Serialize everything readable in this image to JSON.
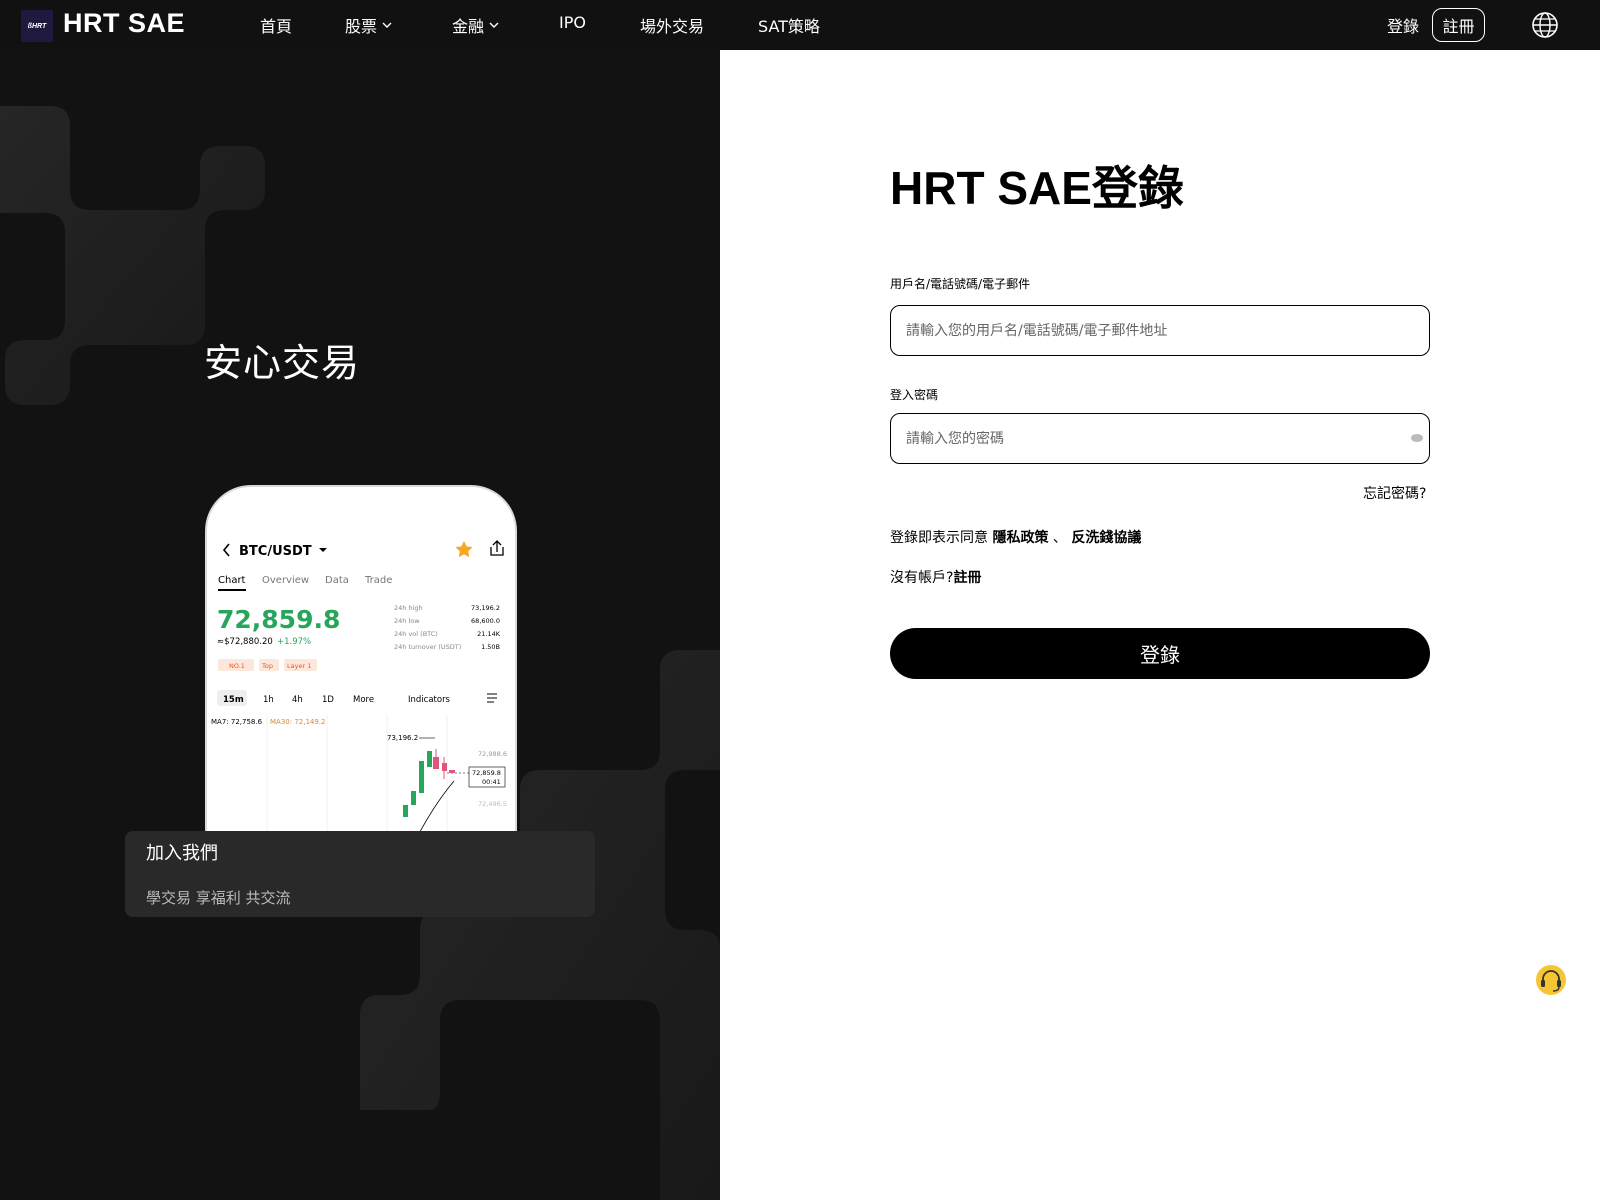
{
  "nav": {
    "logo_text": "ßHRT",
    "brand": "HRT SAE",
    "items": [
      {
        "label": "首頁",
        "dropdown": false
      },
      {
        "label": "股票",
        "dropdown": true
      },
      {
        "label": "金融",
        "dropdown": true
      },
      {
        "label": "IPO",
        "dropdown": false
      },
      {
        "label": "場外交易",
        "dropdown": false
      },
      {
        "label": "SAT策略",
        "dropdown": false
      }
    ],
    "login": "登錄",
    "register": "註冊",
    "language_icon": "globe-icon"
  },
  "left": {
    "hero": "安心交易",
    "phone": {
      "pair": "BTC/USDT",
      "tabs": [
        "Chart",
        "Overview",
        "Data",
        "Trade"
      ],
      "price": "72,859.8",
      "fiat": "≈$72,880.20",
      "change": "+1.97%",
      "stats": [
        {
          "label": "24h high",
          "value": "73,196.2"
        },
        {
          "label": "24h low",
          "value": "68,600.0"
        },
        {
          "label": "24h vol (BTC)",
          "value": "21.14K"
        },
        {
          "label": "24h turnover (USDT)",
          "value": "1.50B"
        }
      ],
      "tags": [
        "NO.1",
        "Top",
        "Layer 1"
      ],
      "intervals": [
        "15m",
        "1h",
        "4h",
        "1D",
        "More"
      ],
      "indicators": "Indicators",
      "ma7": "MA7: 72,758.6",
      "ma30": "MA30: 72,149.2",
      "peak": "73,196.2",
      "level1": "72,988.6",
      "current": "72,859.8",
      "timer": "00:41",
      "level2": "72,496.5"
    },
    "join_title": "加入我們",
    "join_subtitle": "學交易 享福利 共交流"
  },
  "form": {
    "title": "HRT SAE登錄",
    "username_label": "用戶名/電話號碼/電子郵件",
    "username_placeholder": "請輸入您的用戶名/電話號碼/電子郵件地址",
    "password_label": "登入密碼",
    "password_placeholder": "請輸入您的密碼",
    "forgot": "忘記密碼?",
    "agree_prefix": "登錄即表示同意",
    "privacy": "隱私政策",
    "separator": "、",
    "aml": "反洗錢協議",
    "no_account": "沒有帳戶?",
    "register": "註冊",
    "submit": "登錄"
  },
  "colors": {
    "accent": "#000000",
    "up": "#26a65b",
    "star": "#f5a623",
    "tag": "#e55a1c"
  },
  "support_icon": "customer-service-icon"
}
